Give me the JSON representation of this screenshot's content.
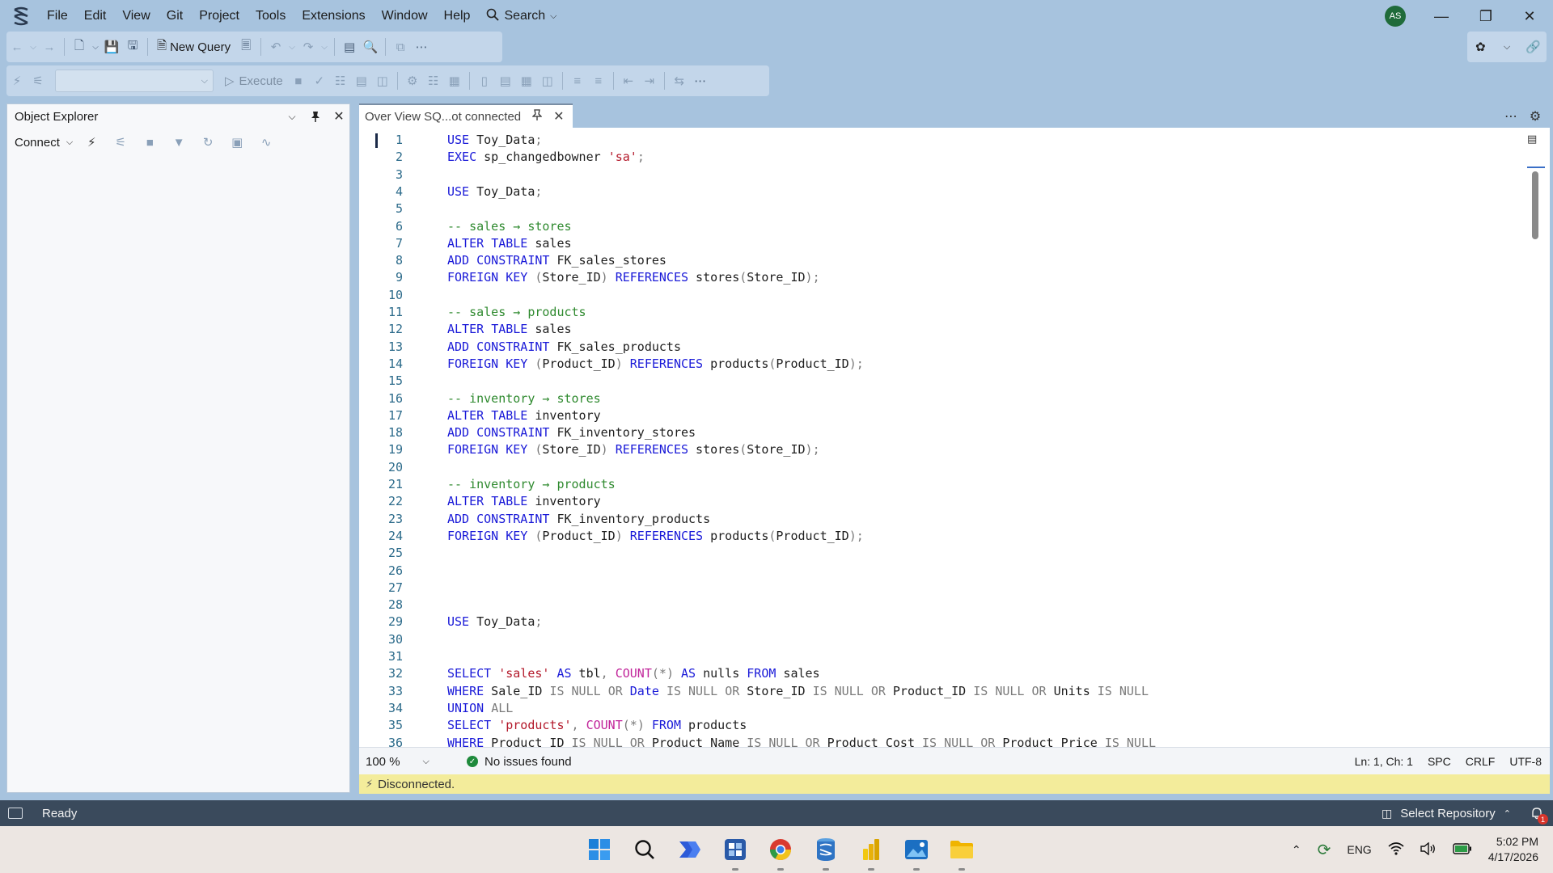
{
  "menu": {
    "items": [
      "File",
      "Edit",
      "View",
      "Git",
      "Project",
      "Tools",
      "Extensions",
      "Window",
      "Help"
    ],
    "search_label": "Search",
    "avatar_initials": "AS"
  },
  "toolbar1": {
    "new_query_label": "New Query"
  },
  "toolbar2": {
    "execute_label": "Execute"
  },
  "object_explorer": {
    "title": "Object Explorer",
    "connect_label": "Connect"
  },
  "tab": {
    "title": "Over View SQ...ot connected"
  },
  "editor": {
    "lines": [
      {
        "n": "1",
        "t": "USE Toy_Data;"
      },
      {
        "n": "2",
        "t": "EXEC sp_changedbowner 'sa';"
      },
      {
        "n": "3",
        "t": ""
      },
      {
        "n": "4",
        "t": "USE Toy_Data;"
      },
      {
        "n": "5",
        "t": ""
      },
      {
        "n": "6",
        "t": "-- sales → stores"
      },
      {
        "n": "7",
        "t": "ALTER TABLE sales"
      },
      {
        "n": "8",
        "t": "ADD CONSTRAINT FK_sales_stores"
      },
      {
        "n": "9",
        "t": "FOREIGN KEY (Store_ID) REFERENCES stores(Store_ID);"
      },
      {
        "n": "10",
        "t": ""
      },
      {
        "n": "11",
        "t": "-- sales → products"
      },
      {
        "n": "12",
        "t": "ALTER TABLE sales"
      },
      {
        "n": "13",
        "t": "ADD CONSTRAINT FK_sales_products"
      },
      {
        "n": "14",
        "t": "FOREIGN KEY (Product_ID) REFERENCES products(Product_ID);"
      },
      {
        "n": "15",
        "t": ""
      },
      {
        "n": "16",
        "t": "-- inventory → stores"
      },
      {
        "n": "17",
        "t": "ALTER TABLE inventory"
      },
      {
        "n": "18",
        "t": "ADD CONSTRAINT FK_inventory_stores"
      },
      {
        "n": "19",
        "t": "FOREIGN KEY (Store_ID) REFERENCES stores(Store_ID);"
      },
      {
        "n": "20",
        "t": ""
      },
      {
        "n": "21",
        "t": "-- inventory → products"
      },
      {
        "n": "22",
        "t": "ALTER TABLE inventory"
      },
      {
        "n": "23",
        "t": "ADD CONSTRAINT FK_inventory_products"
      },
      {
        "n": "24",
        "t": "FOREIGN KEY (Product_ID) REFERENCES products(Product_ID);"
      },
      {
        "n": "25",
        "t": ""
      },
      {
        "n": "26",
        "t": ""
      },
      {
        "n": "27",
        "t": ""
      },
      {
        "n": "28",
        "t": ""
      },
      {
        "n": "29",
        "t": "USE Toy_Data;"
      },
      {
        "n": "30",
        "t": ""
      },
      {
        "n": "31",
        "t": ""
      },
      {
        "n": "32",
        "t": "SELECT 'sales' AS tbl, COUNT(*) AS nulls FROM sales"
      },
      {
        "n": "33",
        "t": "WHERE Sale_ID IS NULL OR Date IS NULL OR Store_ID IS NULL OR Product_ID IS NULL OR Units IS NULL"
      },
      {
        "n": "34",
        "t": "UNION ALL"
      },
      {
        "n": "35",
        "t": "SELECT 'products', COUNT(*) FROM products"
      },
      {
        "n": "36",
        "t": "WHERE Product_ID IS NULL OR Product_Name IS NULL OR Product_Cost IS NULL OR Product_Price IS NULL"
      }
    ]
  },
  "editor_status": {
    "zoom": "100 %",
    "issues": "No issues found",
    "position": "Ln: 1, Ch: 1",
    "spacing": "SPC",
    "line_ending": "CRLF",
    "encoding": "UTF-8"
  },
  "connection_bar": {
    "text": "Disconnected."
  },
  "statusbar": {
    "ready": "Ready",
    "repo": "Select Repository",
    "notification_count": "1"
  },
  "tray": {
    "language": "ENG",
    "time": "5:02 PM",
    "date": "4/17/2026"
  },
  "colors": {
    "keyword": "#1a1ad8",
    "string": "#b3182a",
    "comment": "#2f8a2f",
    "operator": "#7a7a7a",
    "function": "#c1249a",
    "accent": "#a7c3de"
  }
}
